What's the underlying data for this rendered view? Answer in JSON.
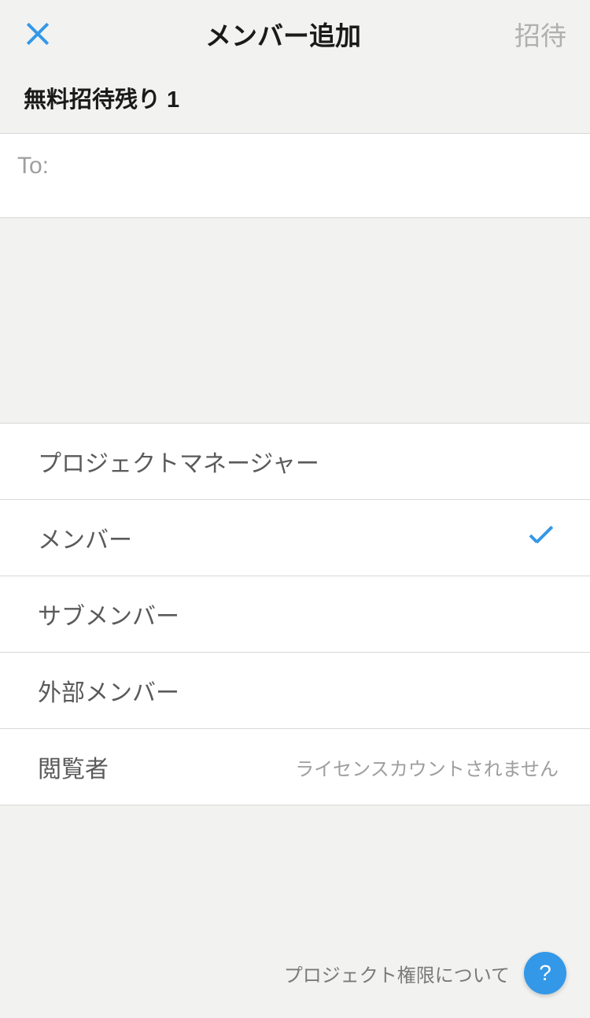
{
  "header": {
    "title": "メンバー追加",
    "invite_label": "招待"
  },
  "subtitle": "無料招待残り 1",
  "to_field": {
    "label": "To:",
    "value": ""
  },
  "roles": [
    {
      "label": "プロジェクトマネージャー",
      "selected": false,
      "note": ""
    },
    {
      "label": "メンバー",
      "selected": true,
      "note": ""
    },
    {
      "label": "サブメンバー",
      "selected": false,
      "note": ""
    },
    {
      "label": "外部メンバー",
      "selected": false,
      "note": ""
    },
    {
      "label": "閲覧者",
      "selected": false,
      "note": "ライセンスカウントされません"
    }
  ],
  "footer": {
    "help_text": "プロジェクト権限について",
    "help_icon": "?"
  }
}
